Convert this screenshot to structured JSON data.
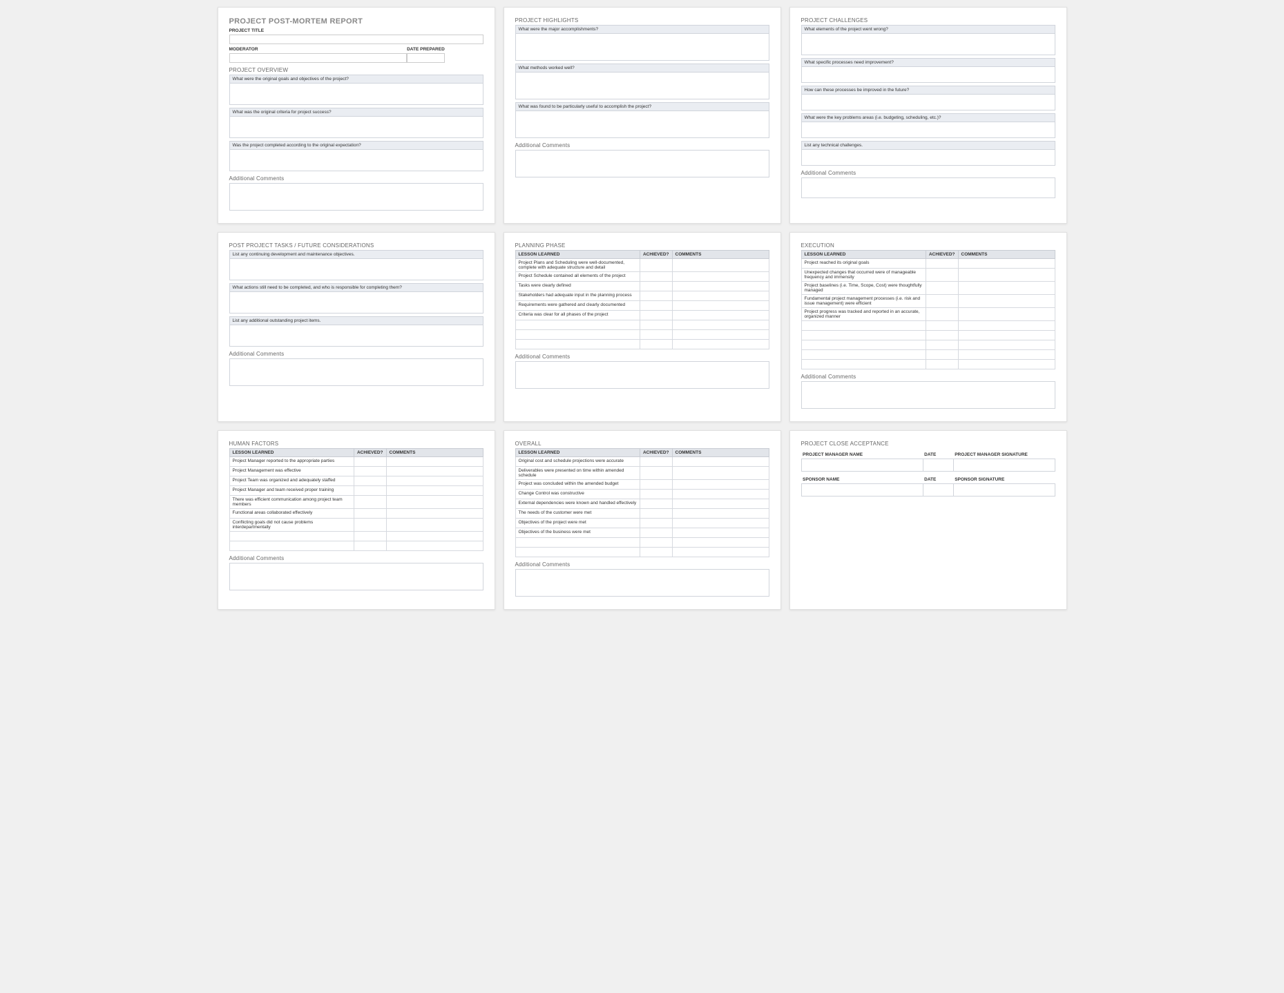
{
  "card1": {
    "main_title": "PROJECT POST-MORTEM REPORT",
    "project_title_label": "PROJECT TITLE",
    "moderator_label": "MODERATOR",
    "date_prepared_label": "DATE PREPARED",
    "overview_title": "PROJECT OVERVIEW",
    "q1": "What were the original goals and objectives of the project?",
    "q2": "What was the original criteria for project success?",
    "q3": "Was the project completed according to the original expectation?",
    "additional_comments": "Additional Comments"
  },
  "card2": {
    "title": "PROJECT HIGHLIGHTS",
    "q1": "What were the major accomplishments?",
    "q2": "What methods worked well?",
    "q3": "What was found to be particularly useful to accomplish the project?",
    "additional_comments": "Additional Comments"
  },
  "card3": {
    "title": "PROJECT CHALLENGES",
    "q1": "What elements of the project went wrong?",
    "q2": "What specific processes need improvement?",
    "q3": "How can these processes be improved in the future?",
    "q4": "What were the key problems areas (i.e. budgeting, scheduling, etc.)?",
    "q5": "List any technical challenges.",
    "additional_comments": "Additional Comments"
  },
  "card4": {
    "title": "POST PROJECT TASKS / FUTURE CONSIDERATIONS",
    "q1": "List any continuing development and maintenance objectives.",
    "q2": "What actions still need to be completed, and who is responsible for completing them?",
    "q3": "List any additional outstanding project items.",
    "additional_comments": "Additional Comments"
  },
  "card5": {
    "title": "PLANNING PHASE",
    "th_lesson": "LESSON LEARNED",
    "th_achieved": "ACHIEVED?",
    "th_comments": "COMMENTS",
    "rows": [
      "Project Plans and Scheduling were well-documented, complete with adequate structure and detail",
      "Project Schedule contained all elements of the project",
      "Tasks were clearly defined",
      "Stakeholders had adequate input in the planning process",
      "Requirements were gathered and clearly documented",
      "Criteria was clear for all phases of the project",
      "",
      "",
      ""
    ],
    "additional_comments": "Additional Comments"
  },
  "card6": {
    "title": "EXECUTION",
    "th_lesson": "LESSON LEARNED",
    "th_achieved": "ACHIEVED?",
    "th_comments": "COMMENTS",
    "rows": [
      "Project reached its original goals",
      "Unexpected changes that occurred were of manageable frequency and immensity",
      "Project baselines (i.e. Time, Scope, Cost) were thoughtfully managed",
      "Fundamental project management processes (i.e. risk and issue management) were efficient",
      "Project progress was tracked and reported in an accurate, organized manner",
      "",
      "",
      "",
      "",
      ""
    ],
    "additional_comments": "Additional Comments"
  },
  "card7": {
    "title": "HUMAN FACTORS",
    "th_lesson": "LESSON LEARNED",
    "th_achieved": "ACHIEVED?",
    "th_comments": "COMMENTS",
    "rows": [
      "Project Manager reported to the appropriate parties",
      "Project Management was effective",
      "Project Team was organized and adequately staffed",
      "Project Manager and team received proper training",
      "There was efficient communication among project team members",
      "Functional areas collaborated effectively",
      "Conflicting goals did not cause problems interdepartmentally",
      "",
      ""
    ],
    "additional_comments": "Additional Comments"
  },
  "card8": {
    "title": "OVERALL",
    "th_lesson": "LESSON LEARNED",
    "th_achieved": "ACHIEVED?",
    "th_comments": "COMMENTS",
    "rows": [
      "Original cost and schedule projections were accurate",
      "Deliverables were presented on time within amended schedule",
      "Project was concluded within the amended budget",
      "Change Control was constructive",
      "External dependencies were known and handled effectively",
      "The needs of the customer were met",
      "Objectives of the project were met",
      "Objectives of the business were met",
      "",
      ""
    ],
    "additional_comments": "Additional Comments"
  },
  "card9": {
    "title": "PROJECT CLOSE ACCEPTANCE",
    "pm_name": "PROJECT MANAGER NAME",
    "date": "DATE",
    "pm_sig": "PROJECT MANAGER SIGNATURE",
    "sponsor_name": "SPONSOR NAME",
    "sponsor_sig": "SPONSOR SIGNATURE"
  }
}
